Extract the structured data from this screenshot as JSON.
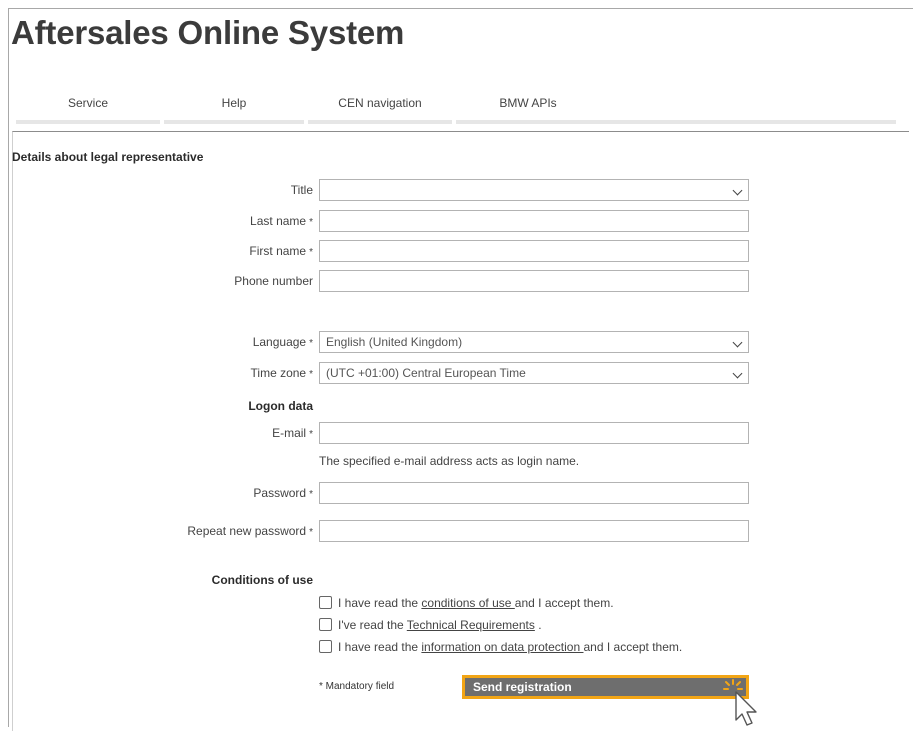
{
  "app": {
    "title": "Aftersales Online System"
  },
  "nav": {
    "items": [
      {
        "label": "Service"
      },
      {
        "label": "Help"
      },
      {
        "label": "CEN navigation"
      },
      {
        "label": "BMW APIs"
      }
    ]
  },
  "section": {
    "title": "Details about legal representative"
  },
  "form": {
    "required_marker": "*",
    "title": {
      "label": "Title",
      "value": ""
    },
    "last_name": {
      "label": "Last name",
      "value": ""
    },
    "first_name": {
      "label": "First name",
      "value": ""
    },
    "phone": {
      "label": "Phone number",
      "value": ""
    },
    "language": {
      "label": "Language",
      "value": "English (United Kingdom)"
    },
    "timezone": {
      "label": "Time zone",
      "value": "(UTC +01:00) Central European Time"
    },
    "logon_heading": "Logon data",
    "email": {
      "label": "E-mail",
      "value": ""
    },
    "email_hint": "The specified e-mail address acts as login name.",
    "password": {
      "label": "Password",
      "value": ""
    },
    "repeat_password": {
      "label": "Repeat new password",
      "value": ""
    }
  },
  "conditions": {
    "heading": "Conditions of use",
    "items": [
      {
        "pre": "I have read the ",
        "link": "conditions of use ",
        "post": "and I accept them.",
        "checked": false
      },
      {
        "pre": "I've read the ",
        "link": "Technical Requirements",
        "post": " .",
        "checked": false
      },
      {
        "pre": "I have read the ",
        "link": "information on data protection ",
        "post": "and I accept them.",
        "checked": false
      }
    ]
  },
  "footer": {
    "mandatory_note": "* Mandatory field",
    "submit_label": "Send registration"
  },
  "colors": {
    "accent": "#f2a515",
    "button_bg": "#6e6e6e"
  },
  "icons": {
    "dropdown": "chevron-down-icon",
    "cursor": "mouse-pointer-icon",
    "highlight": "click-highlight-icon"
  }
}
